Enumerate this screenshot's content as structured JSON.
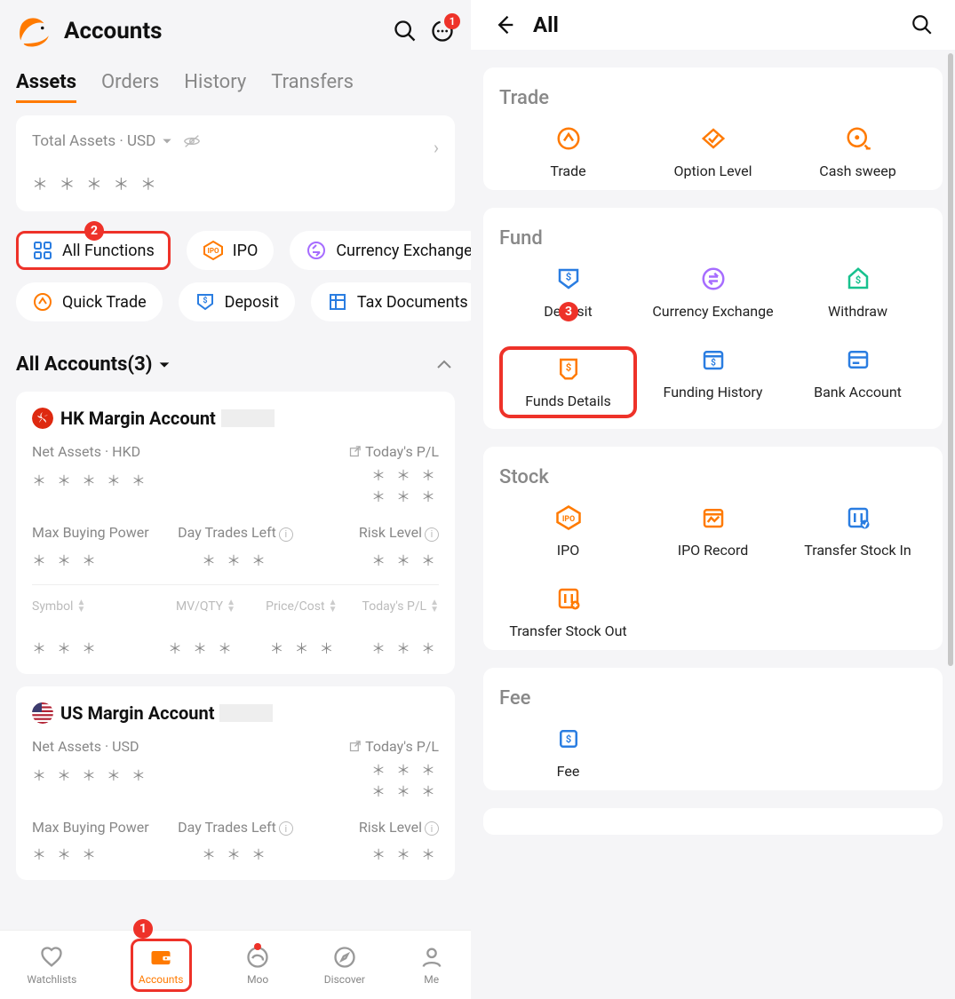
{
  "left": {
    "title": "Accounts",
    "chat_badge": "1",
    "tabs": [
      "Assets",
      "Orders",
      "History",
      "Transfers"
    ],
    "total_label": "Total Assets · USD",
    "mask5": "＊ ＊ ＊ ＊ ＊",
    "chips": {
      "all": "All Functions",
      "ipo": "IPO",
      "cx": "Currency Exchange",
      "qt": "Quick Trade",
      "dep": "Deposit",
      "tax": "Tax Documents"
    },
    "acc_hdr": "All Accounts(3)",
    "hk": {
      "name": "HK Margin Account",
      "net": "Net Assets · HKD",
      "pl": "Today's P/L",
      "mbp": "Max Buying Power",
      "dtl": "Day Trades Left",
      "rl": "Risk Level",
      "c1": "Symbol",
      "c2": "MV/QTY",
      "c3": "Price/Cost",
      "c4": "Today's P/L"
    },
    "us": {
      "name": "US Margin Account",
      "net": "Net Assets · USD",
      "pl": "Today's P/L",
      "mbp": "Max Buying Power",
      "dtl": "Day Trades Left",
      "rl": "Risk Level"
    },
    "mask3": "＊ ＊ ＊",
    "bnav": [
      "Watchlists",
      "Accounts",
      "Moo",
      "Discover",
      "Me"
    ]
  },
  "right": {
    "title": "All",
    "sections": {
      "trade": {
        "title": "Trade",
        "items": [
          "Trade",
          "Option Level",
          "Cash sweep"
        ]
      },
      "fund": {
        "title": "Fund",
        "items": [
          "Deposit",
          "Currency Exchange",
          "Withdraw",
          "Funds Details",
          "Funding History",
          "Bank Account"
        ]
      },
      "stock": {
        "title": "Stock",
        "items": [
          "IPO",
          "IPO Record",
          "Transfer Stock In",
          "Transfer Stock Out"
        ]
      },
      "fee": {
        "title": "Fee",
        "items": [
          "Fee"
        ]
      }
    }
  },
  "markers": {
    "m1": "1",
    "m2": "2",
    "m3": "3"
  }
}
